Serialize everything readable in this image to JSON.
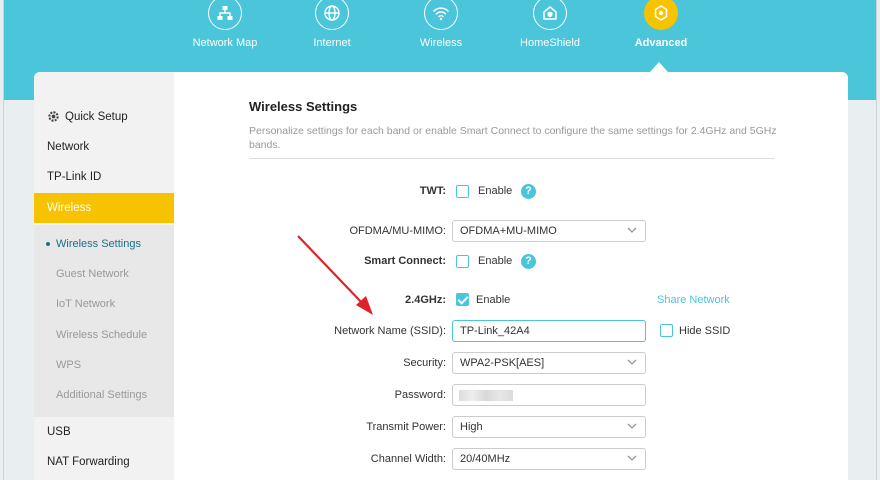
{
  "topnav": {
    "items": [
      {
        "label": "Network Map",
        "icon": "network-map-icon"
      },
      {
        "label": "Internet",
        "icon": "globe-icon"
      },
      {
        "label": "Wireless",
        "icon": "wifi-icon"
      },
      {
        "label": "HomeShield",
        "icon": "homeshield-icon"
      },
      {
        "label": "Advanced",
        "icon": "gear-icon",
        "active": true
      }
    ]
  },
  "sidebar": {
    "items": [
      {
        "label": "Quick Setup",
        "icon": "gear-icon"
      },
      {
        "label": "Network"
      },
      {
        "label": "TP-Link ID"
      },
      {
        "label": "Wireless",
        "active": true
      },
      {
        "label": "USB"
      },
      {
        "label": "NAT Forwarding"
      }
    ],
    "subitems": [
      {
        "label": "Wireless Settings",
        "active": true
      },
      {
        "label": "Guest Network"
      },
      {
        "label": "IoT Network"
      },
      {
        "label": "Wireless Schedule"
      },
      {
        "label": "WPS"
      },
      {
        "label": "Additional Settings"
      }
    ]
  },
  "content": {
    "title": "Wireless Settings",
    "description": "Personalize settings for each band or enable Smart Connect to configure the same settings for 2.4GHz and 5GHz bands.",
    "twt": {
      "label": "TWT:",
      "checkbox_label": "Enable",
      "checked": false
    },
    "ofdma": {
      "label": "OFDMA/MU-MIMO:",
      "value": "OFDMA+MU-MIMO"
    },
    "smart_connect": {
      "label": "Smart Connect:",
      "checkbox_label": "Enable",
      "checked": false
    },
    "band": {
      "label": "2.4GHz:",
      "checkbox_label": "Enable",
      "checked": true,
      "share_link": "Share Network"
    },
    "ssid": {
      "label": "Network Name (SSID):",
      "value": "TP-Link_42A4",
      "hide_label": "Hide SSID",
      "hide_checked": false
    },
    "security": {
      "label": "Security:",
      "value": "WPA2-PSK[AES]"
    },
    "password": {
      "label": "Password:"
    },
    "transmit_power": {
      "label": "Transmit Power:",
      "value": "High"
    },
    "channel_width": {
      "label": "Channel Width:",
      "value": "20/40MHz"
    },
    "help_symbol": "?"
  },
  "colors": {
    "accent": "#4ac5d9",
    "active": "#f7c300",
    "annotation_arrow": "#e0232a"
  }
}
